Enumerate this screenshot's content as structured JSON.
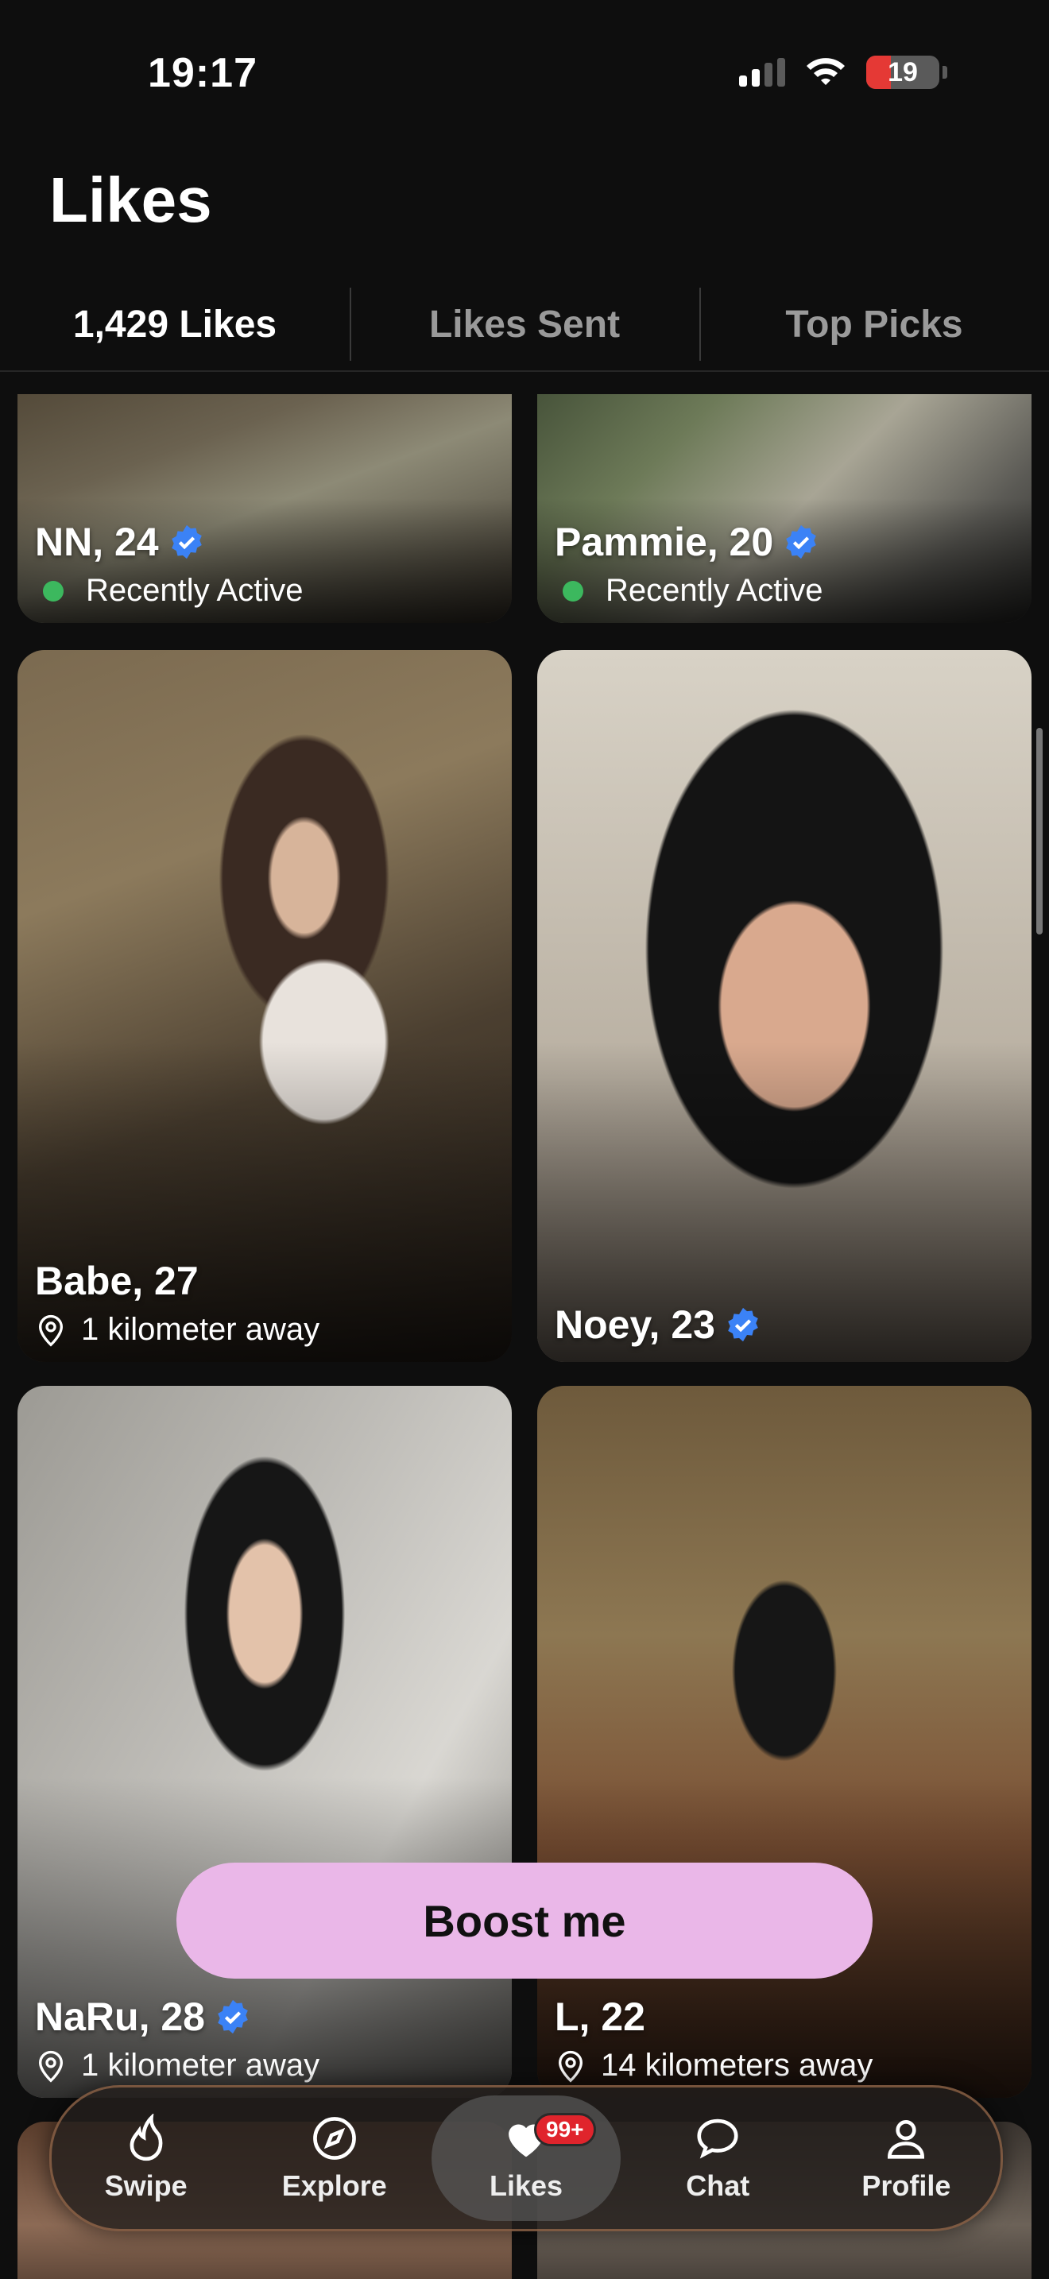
{
  "status": {
    "time": "19:17",
    "battery": "19"
  },
  "header": {
    "title": "Likes"
  },
  "tabs": [
    {
      "label": "1,429 Likes",
      "active": true
    },
    {
      "label": "Likes Sent",
      "active": false
    },
    {
      "label": "Top Picks",
      "active": false
    }
  ],
  "cards": [
    {
      "name": "NN, 24",
      "verified": true,
      "sub": "Recently Active",
      "sub_type": "active"
    },
    {
      "name": "Pammie, 20",
      "verified": true,
      "sub": "Recently Active",
      "sub_type": "active"
    },
    {
      "name": "Babe, 27",
      "verified": false,
      "sub": "1 kilometer away",
      "sub_type": "distance"
    },
    {
      "name": "Noey, 23",
      "verified": true,
      "sub": "",
      "sub_type": "none"
    },
    {
      "name": "NaRu, 28",
      "verified": true,
      "sub": "1 kilometer away",
      "sub_type": "distance"
    },
    {
      "name": "L, 22",
      "verified": false,
      "sub": "14 kilometers away",
      "sub_type": "distance"
    }
  ],
  "boost": {
    "label": "Boost me"
  },
  "nav": {
    "items": [
      {
        "label": "Swipe",
        "icon": "flame-icon"
      },
      {
        "label": "Explore",
        "icon": "compass-icon"
      },
      {
        "label": "Likes",
        "icon": "heart-icon",
        "badge": "99+"
      },
      {
        "label": "Chat",
        "icon": "chat-bubble-icon"
      },
      {
        "label": "Profile",
        "icon": "person-icon"
      }
    ]
  },
  "colors": {
    "background": "#0e0e0e",
    "boost": "#eab7e8",
    "active_dot": "#3cb85e",
    "verified": "#3b82f6",
    "badge": "#e0242c"
  }
}
